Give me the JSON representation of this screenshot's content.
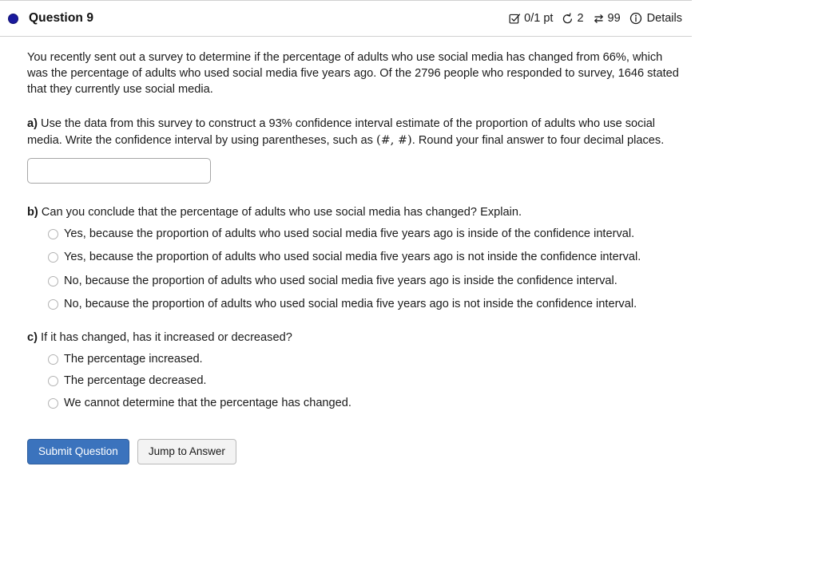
{
  "header": {
    "status_dot_color": "#1a1a9e",
    "title": "Question 9",
    "score": "0/1 pt",
    "attempts": "2",
    "version": "99",
    "details_label": "Details",
    "icons": {
      "score": "checkbox-check-icon",
      "attempts": "retry-arrow-icon",
      "version": "swap-arrows-icon",
      "details": "info-circle-icon"
    }
  },
  "question": {
    "intro": "You recently sent out a survey to determine if the percentage of adults who use social media has changed from 66%, which was the percentage of adults who used social media five years ago. Of the 2796 people who responded to survey, 1646 stated that they currently use social media.",
    "part_a": {
      "label": "a)",
      "text_before_math": " Use the data from this survey to construct a 93% confidence interval estimate of the proportion of adults who use social media. Write the confidence interval by using parentheses, such as ",
      "math": "(#, #)",
      "text_after_math": ". Round your final answer to four decimal places.",
      "input_value": "",
      "input_placeholder": ""
    },
    "part_b": {
      "label": "b)",
      "text": " Can you conclude that the percentage of adults who use social media has changed? Explain.",
      "options": [
        "Yes, because the proportion of adults who used social media five years ago is inside of the confidence interval.",
        "Yes, because the proportion of adults who used social media five years ago is not inside the confidence interval.",
        "No, because the proportion of adults who used social media five years ago is inside the confidence interval.",
        "No, because the proportion of adults who used social media five years ago is not inside the confidence interval."
      ]
    },
    "part_c": {
      "label": "c)",
      "text": " If it has changed, has it increased or decreased?",
      "options": [
        "The percentage increased.",
        "The percentage decreased.",
        "We cannot determine that the percentage has changed."
      ]
    }
  },
  "actions": {
    "submit_label": "Submit Question",
    "jump_label": "Jump to Answer",
    "primary_color": "#3b73bd"
  }
}
